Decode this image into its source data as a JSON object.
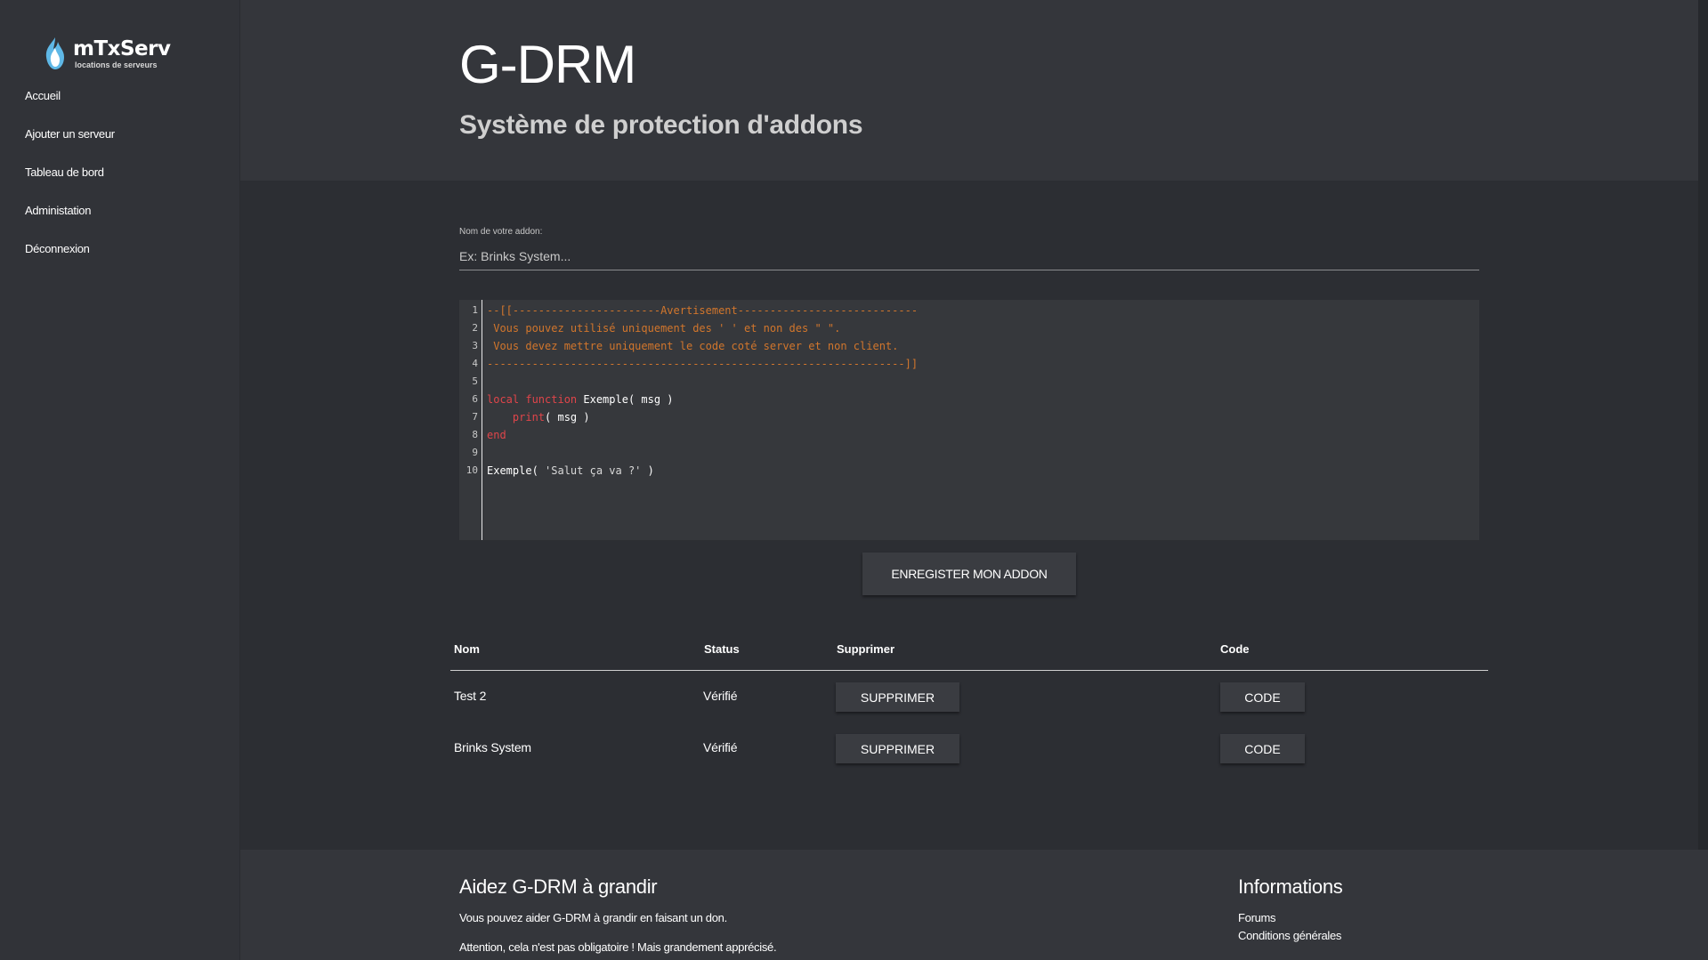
{
  "brand": {
    "name": "mTxServ",
    "tagline": "locations de serveurs",
    "logo_icon": "flame-icon"
  },
  "sidebar": {
    "items": [
      {
        "label": "Accueil"
      },
      {
        "label": "Ajouter un serveur"
      },
      {
        "label": "Tableau de bord"
      },
      {
        "label": "Administation"
      },
      {
        "label": "Déconnexion"
      }
    ]
  },
  "header": {
    "title": "G-DRM",
    "subtitle": "Système de protection d'addons"
  },
  "form": {
    "name_label": "Nom de votre addon:",
    "name_placeholder": "Ex: Brinks System...",
    "save_label": "ENREGISTER MON ADDON"
  },
  "editor": {
    "line_numbers": [
      "1",
      "2",
      "3",
      "4",
      "5",
      "6",
      "7",
      "8",
      "9",
      "10"
    ],
    "lines": {
      "l1": "--[[-----------------------Avertisement----------------------------",
      "l2": " Vous pouvez utilisé uniquement des ' ' et non des \" \".",
      "l3": " Vous devez mettre uniquement le code coté server et non client.",
      "l4": "-----------------------------------------------------------------]]",
      "l6_kw1": "local",
      "l6_kw2": "function",
      "l6_rest": " Exemple( msg )",
      "l7_kw": "print",
      "l7_rest": "( msg )",
      "l8_kw": "end",
      "l10_fn": "Exemple( ",
      "l10_str": "'Salut ça va ?'",
      "l10_end": " )"
    }
  },
  "table": {
    "headers": {
      "name": "Nom",
      "status": "Status",
      "delete": "Supprimer",
      "code": "Code"
    },
    "rows": [
      {
        "name": "Test 2",
        "status": "Vérifié",
        "delete_label": "SUPPRIMER",
        "code_label": "CODE"
      },
      {
        "name": "Brinks System",
        "status": "Vérifié",
        "delete_label": "SUPPRIMER",
        "code_label": "CODE"
      }
    ]
  },
  "footer": {
    "left_title": "Aidez G-DRM à grandir",
    "left_text_1": "Vous pouvez aider G-DRM à grandir en faisant un don.",
    "left_text_2": "Attention, cela n'est pas obligatoire ! Mais grandement apprécisé.",
    "right_title": "Informations",
    "links": [
      {
        "label": "Forums"
      },
      {
        "label": "Conditions générales"
      }
    ]
  },
  "colors": {
    "background": "#2c2e33",
    "panel": "#34363b",
    "comment": "#d2762c",
    "keyword": "#e0454a"
  }
}
